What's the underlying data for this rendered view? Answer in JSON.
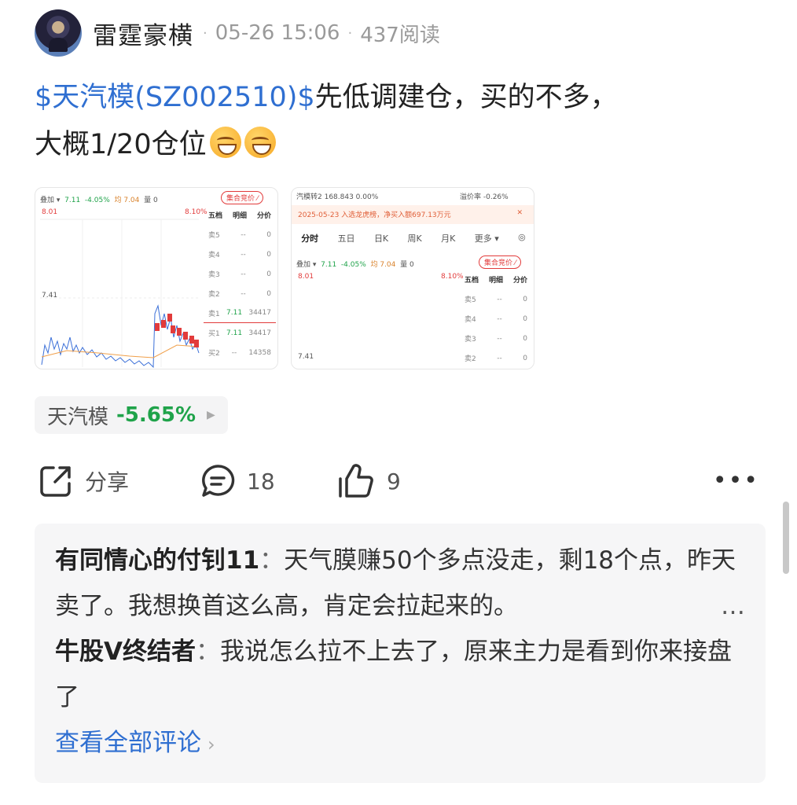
{
  "header": {
    "author": "雷霆豪横",
    "date": "05-26 15:06",
    "reads": "437阅读"
  },
  "post": {
    "stock_tag": "$天汽模(SZ002510)$",
    "text_line1": "先低调建仓，买的不多，",
    "text_line2": "大概1/20仓位"
  },
  "thumb1": {
    "toolbar": "叠加 ▾",
    "price": "7.11",
    "change": "-4.05%",
    "avg": "均 7.04",
    "volume": "量 0",
    "badge": "集合竞价",
    "high": "8.01",
    "high_pct": "8.10%",
    "mid": "7.41",
    "book": {
      "head": [
        "五档",
        "明细",
        "分价"
      ],
      "rows": [
        [
          "卖5",
          "--",
          "0"
        ],
        [
          "卖4",
          "--",
          "0"
        ],
        [
          "卖3",
          "--",
          "0"
        ],
        [
          "卖2",
          "--",
          "0"
        ],
        [
          "卖1",
          "7.11",
          "34417"
        ],
        [
          "买1",
          "7.11",
          "34417"
        ],
        [
          "买2",
          "--",
          "14358"
        ]
      ]
    }
  },
  "thumb2": {
    "top_left": "汽模转2  168.843  0.00%",
    "top_right": "溢价率  -0.26%",
    "notice": "2025-05-23 入选龙虎榜，净买入额697.13万元",
    "tabs": [
      "分时",
      "五日",
      "日K",
      "周K",
      "月K",
      "更多 ▾"
    ],
    "toolbar": "叠加 ▾",
    "price": "7.11",
    "change": "-4.05%",
    "avg": "均 7.04",
    "volume": "量 0",
    "badge": "集合竞价",
    "high": "8.01",
    "high_pct": "8.10%",
    "mid": "7.41",
    "book": {
      "head": [
        "五档",
        "明细",
        "分价"
      ],
      "rows": [
        [
          "卖5",
          "--",
          "0"
        ],
        [
          "卖4",
          "--",
          "0"
        ],
        [
          "卖3",
          "--",
          "0"
        ],
        [
          "卖2",
          "--",
          "0"
        ]
      ]
    }
  },
  "stock_chip": {
    "name": "天汽模",
    "change": "-5.65%"
  },
  "actions": {
    "share": "分享",
    "comments": "18",
    "likes": "9"
  },
  "comments": [
    {
      "author": "有同情心的付钊11",
      "text": "天气膜赚50个多点没走，剩18个点，昨天卖了。我想换首这么高，肯定会拉起来的。"
    },
    {
      "author": "牛股V终结者",
      "text": "我说怎么拉不上去了，原来主力是看到你来接盘了"
    }
  ],
  "view_all": "查看全部评论",
  "colors": {
    "link": "#2f6fd1",
    "down": "#1fa34a",
    "up": "#e23b3b"
  }
}
